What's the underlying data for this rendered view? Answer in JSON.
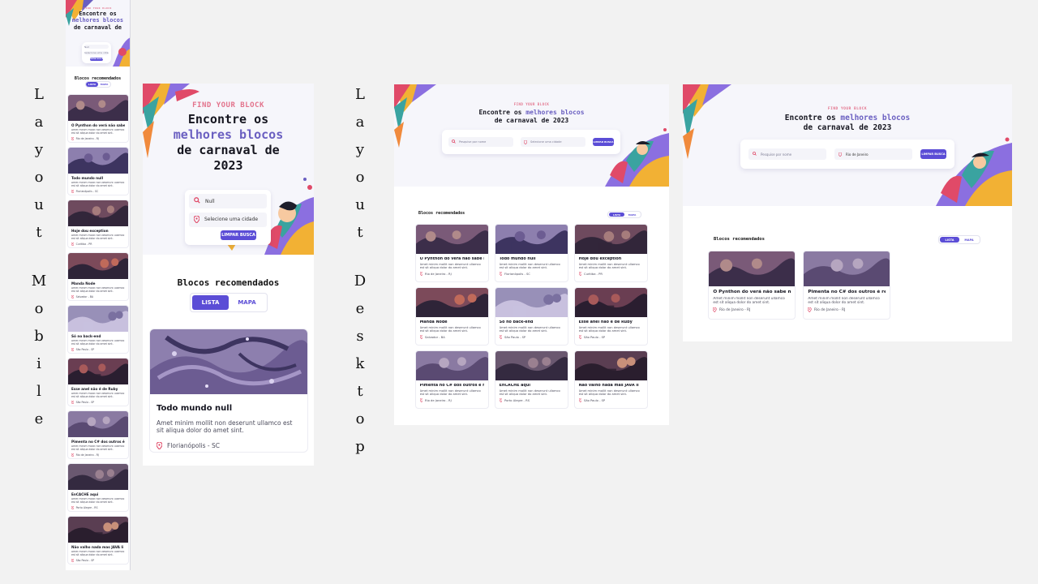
{
  "labels": {
    "mobile": [
      "L",
      "a",
      "y",
      "o",
      "u",
      "t",
      "",
      "M",
      "o",
      "b",
      "i",
      "l",
      "e"
    ],
    "desktop": [
      "L",
      "a",
      "y",
      "o",
      "u",
      "t",
      "",
      "D",
      "e",
      "s",
      "k",
      "t",
      "o",
      "p"
    ]
  },
  "hero": {
    "tag": "FIND YOUR BLOCK",
    "title_l1": "Encontre os",
    "title_accent": "melhores blocos",
    "title_l3": "de carnaval de",
    "title_l4": "2023",
    "title_d1": "Encontre os",
    "title_d2": "de carnaval de 2023"
  },
  "search": {
    "name_value": "Null",
    "name_placeholder": "Pesquise por nome",
    "city_placeholder": "Selecione uma cidade",
    "city_value_rj": "Rio de Janeiro",
    "clear_label": "LIMPAR BUSCA"
  },
  "section": {
    "title": "Blocos recomendados",
    "list_label": "LISTA",
    "map_label": "MAPA"
  },
  "card_desc": "Amet minim mollit non deserunt ullamco est sit aliqua dolor do amet sint.",
  "blocks": [
    {
      "name": "O Pynthon do verá não sabe mais",
      "city": "Rio de Janeiro - RJ"
    },
    {
      "name": "Todo mundo null",
      "city": "Florianópolis - SC"
    },
    {
      "name": "Hoje dou exception",
      "city": "Curitiba - PR"
    },
    {
      "name": "Manda Node",
      "city": "Salvador - BA"
    },
    {
      "name": "Só no back-end",
      "city": "São Paulo - SP"
    },
    {
      "name": "Esse anel não é de Ruby",
      "city": "São Paulo - SP"
    },
    {
      "name": "Pimenta no C# dos outros é refresco",
      "city": "Rio de Janeiro - RJ"
    },
    {
      "name": "EnCACHE aqui",
      "city": "Porto Alegre - RS"
    },
    {
      "name": "Não valho nada mas JAVA li",
      "city": "São Paulo - SP"
    }
  ],
  "colors": {
    "accent": "#5b4dd6",
    "title_accent": "#6a5fc1",
    "tag": "#e3738c",
    "pin": "#e04a68",
    "hero_bg": "#f6f6fb"
  }
}
